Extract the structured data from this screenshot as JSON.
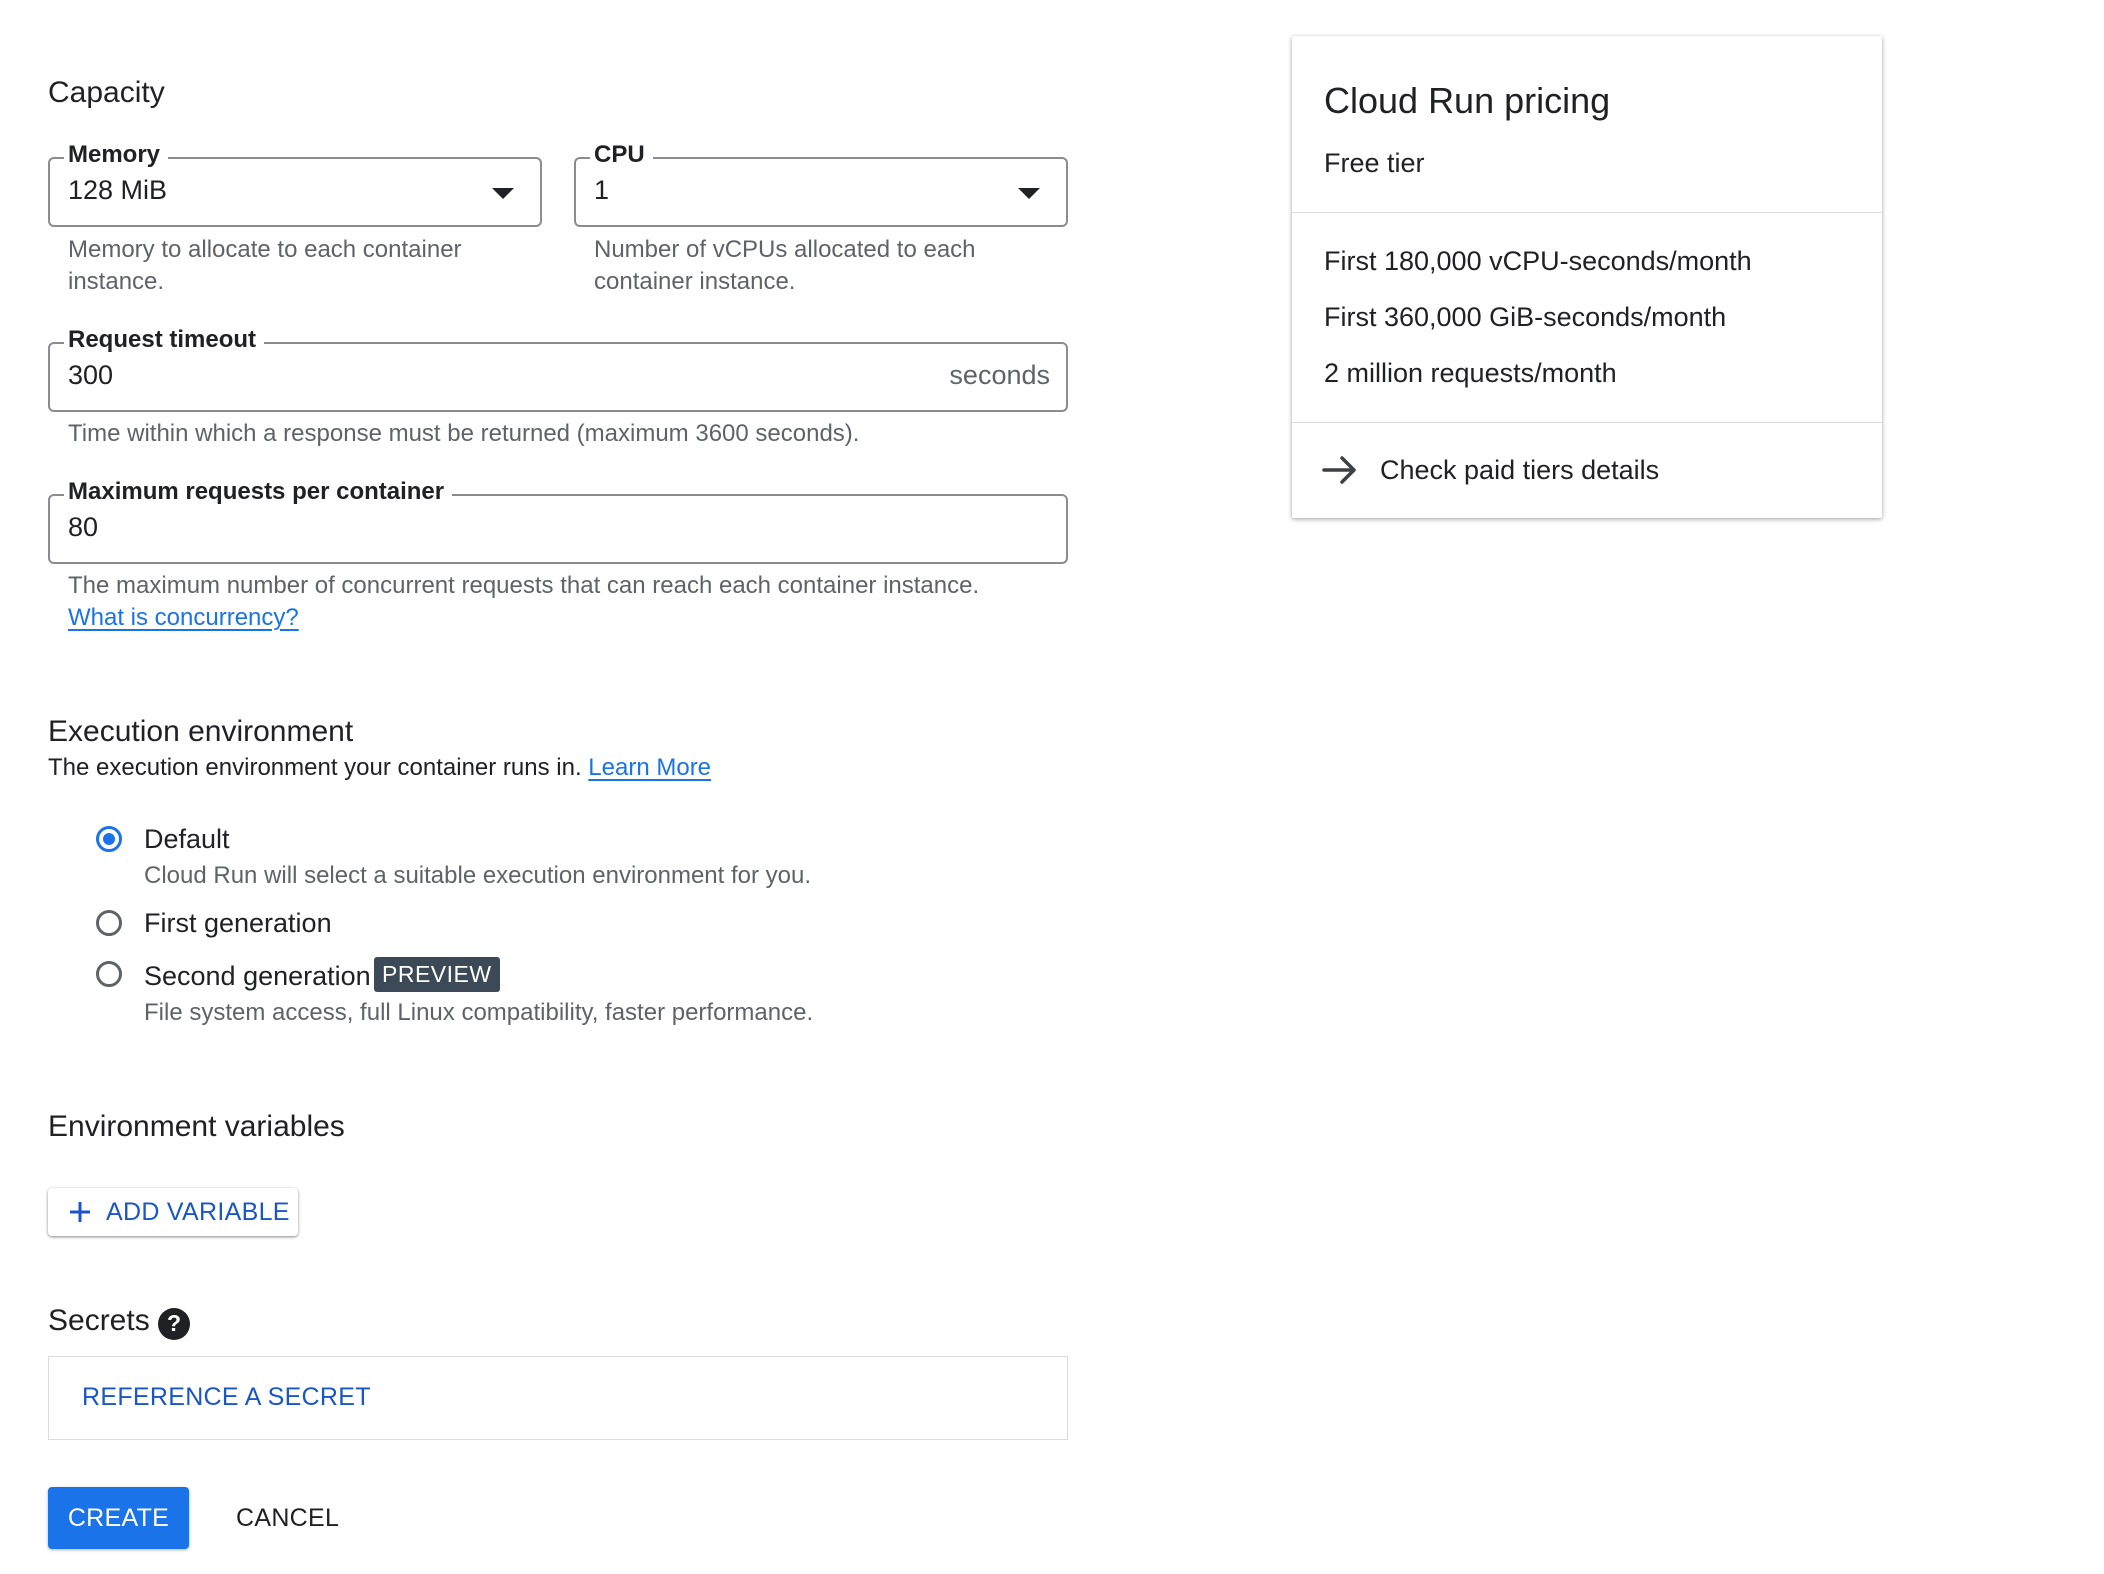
{
  "capacity": {
    "title": "Capacity",
    "memory": {
      "label": "Memory",
      "value": "128 MiB",
      "helper_line1": "Memory to allocate to each container",
      "helper_line2": "instance."
    },
    "cpu": {
      "label": "CPU",
      "value": "1",
      "helper_line1": "Number of vCPUs allocated to each",
      "helper_line2": "container instance."
    },
    "timeout": {
      "label": "Request timeout",
      "value": "300",
      "suffix": "seconds",
      "helper": "Time within which a response must be returned (maximum 3600 seconds)."
    },
    "max_requests": {
      "label": "Maximum requests per container",
      "value": "80",
      "helper": "The maximum number of concurrent requests that can reach each container instance.",
      "link": "What is concurrency?"
    }
  },
  "execution": {
    "title": "Execution environment",
    "description": "The execution environment your container runs in.",
    "learn_more": "Learn More",
    "options": [
      {
        "label": "Default",
        "description": "Cloud Run will select a suitable execution environment for you.",
        "checked": true
      },
      {
        "label": "First generation",
        "description": "",
        "checked": false
      },
      {
        "label": "Second generation",
        "badge": "PREVIEW",
        "description": "File system access, full Linux compatibility, faster performance.",
        "checked": false
      }
    ]
  },
  "env_vars": {
    "title": "Environment variables",
    "add_button": "ADD VARIABLE"
  },
  "secrets": {
    "title": "Secrets",
    "reference_button": "REFERENCE A SECRET"
  },
  "actions": {
    "create": "CREATE",
    "cancel": "CANCEL"
  },
  "pricing": {
    "title": "Cloud Run pricing",
    "subtitle": "Free tier",
    "items": [
      "First 180,000 vCPU-seconds/month",
      "First 360,000 GiB-seconds/month",
      "2 million requests/month"
    ],
    "paid_link": "Check paid tiers details"
  },
  "colors": {
    "accent": "#1a73e8",
    "primary_button": "#1a73e8",
    "badge": "#3c4a57"
  }
}
